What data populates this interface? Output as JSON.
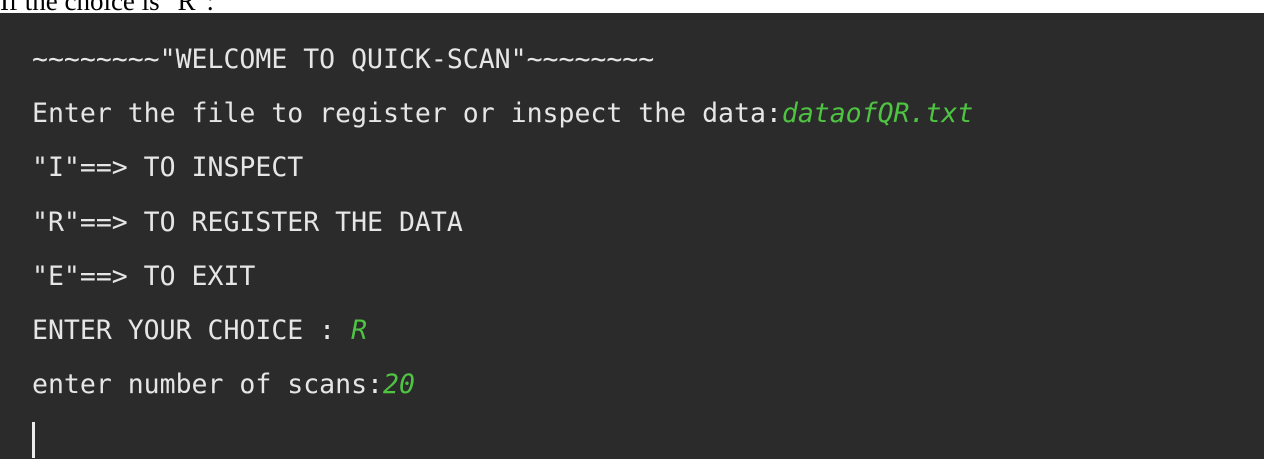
{
  "document": {
    "caption": "If the choice is \"R\":"
  },
  "terminal": {
    "banner": "~~~~~~~~\"WELCOME TO QUICK-SCAN\"~~~~~~~~",
    "file_prompt": "Enter the file to register or inspect the data:",
    "file_input": "dataofQR.txt",
    "menu": [
      "\"I\"==> TO INSPECT",
      "\"R\"==> TO REGISTER THE DATA",
      "\"E\"==> TO EXIT"
    ],
    "choice_prompt": "ENTER YOUR CHOICE : ",
    "choice_input": "R",
    "scans_prompt": "enter number of scans:",
    "scans_input": "20"
  },
  "colors": {
    "background": "#2b2b2b",
    "output_text": "#e6e6e6",
    "user_input": "#4fc442"
  }
}
